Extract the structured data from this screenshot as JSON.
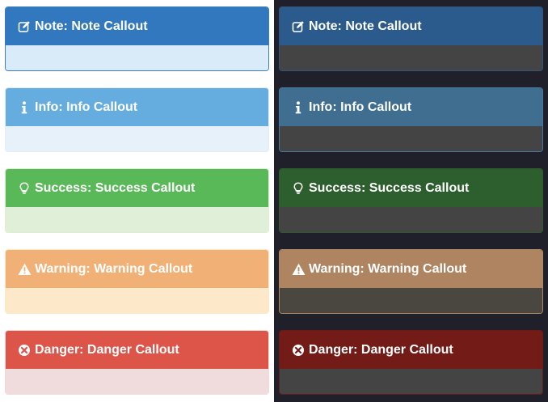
{
  "callouts": [
    {
      "type": "note",
      "icon": "edit-icon",
      "title": "Note: Note Callout"
    },
    {
      "type": "info",
      "icon": "info-icon",
      "title": "Info: Info Callout"
    },
    {
      "type": "success",
      "icon": "lightbulb-icon",
      "title": "Success: Success Callout"
    },
    {
      "type": "warning",
      "icon": "warning-triangle-icon",
      "title": "Warning: Warning Callout"
    },
    {
      "type": "danger",
      "icon": "close-circle-icon",
      "title": "Danger: Danger Callout"
    }
  ],
  "colors": {
    "light": {
      "note": "#3178bf",
      "info": "#66addf",
      "success": "#59b958",
      "warning": "#f1b176",
      "danger": "#dd5449"
    },
    "dark": {
      "note": "#2a5b8c",
      "info": "#3f6e91",
      "success": "#2d5e2d",
      "warning": "#ae8461",
      "danger": "#731b17",
      "background": "#1f2029"
    }
  }
}
